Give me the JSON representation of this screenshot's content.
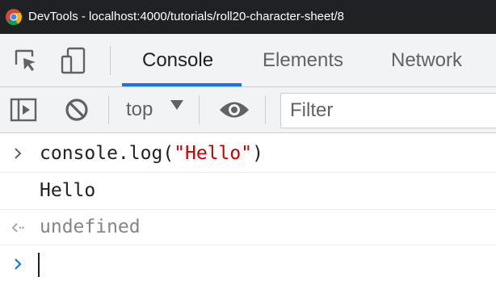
{
  "window": {
    "title": "DevTools - localhost:4000/tutorials/roll20-character-sheet/8"
  },
  "tabs": [
    {
      "label": "Console",
      "active": true
    },
    {
      "label": "Elements",
      "active": false
    },
    {
      "label": "Network",
      "active": false
    }
  ],
  "toolbar": {
    "context": "top",
    "filter_placeholder": "Filter",
    "icons": [
      "sidebar-toggle-icon",
      "clear-console-icon",
      "eye-icon"
    ]
  },
  "console": {
    "entries": [
      {
        "kind": "input",
        "code_prefix": "console.log(",
        "string": "\"Hello\"",
        "code_suffix": ")"
      },
      {
        "kind": "log",
        "text": "Hello"
      },
      {
        "kind": "result",
        "text": "undefined"
      }
    ],
    "prompt": ""
  },
  "colors": {
    "accent": "#1a73e8",
    "string": "#c80000",
    "titlebar": "#202124",
    "toolbar_bg": "#f1f3f4"
  }
}
